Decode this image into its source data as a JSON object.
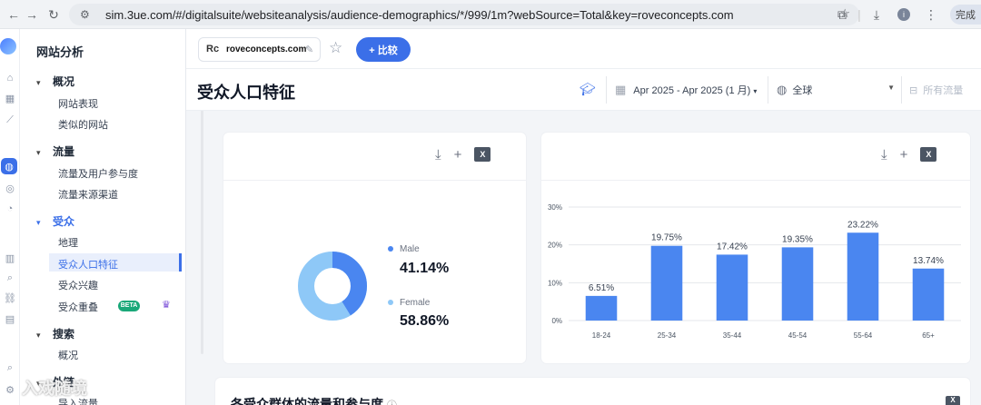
{
  "browser": {
    "url": "sim.3ue.com/#/digitalsuite/websiteanalysis/audience-demographics/*/999/1m?webSource=Total&key=roveconcepts.com",
    "profile_label": "完成",
    "avatar_initial": "i"
  },
  "sidebar": {
    "title": "网站分析",
    "sections": [
      {
        "label": "概况",
        "items": [
          "网站表现",
          "类似的网站"
        ]
      },
      {
        "label": "流量",
        "items": [
          "流量及用户参与度",
          "流量来源渠道"
        ]
      },
      {
        "label": "受众",
        "items": [
          "地理",
          "受众人口特征",
          "受众兴趣",
          "受众重叠"
        ]
      },
      {
        "label": "搜索",
        "items": [
          "概况"
        ]
      },
      {
        "label": "外链",
        "items": [
          "导入流量"
        ]
      }
    ],
    "beta_badge": "BETA"
  },
  "header": {
    "domain": "roveconcepts.com",
    "favicon_text": "Rc",
    "compare_label": "+ 比较"
  },
  "page": {
    "title": "受众人口特征",
    "date_range": "Apr 2025 - Apr 2025 (1 月)",
    "geo": "全球",
    "traffic": "所有流量"
  },
  "gender_card": {
    "male_label": "Male",
    "male_value": "41.14%",
    "female_label": "Female",
    "female_value": "58.86%",
    "male_color": "#4a86f0",
    "female_color": "#8ec8f7"
  },
  "chart_data": {
    "type": "bar",
    "categories": [
      "18-24",
      "25-34",
      "35-44",
      "45-54",
      "55-64",
      "65+"
    ],
    "values": [
      6.51,
      19.75,
      17.42,
      19.35,
      23.22,
      13.74
    ],
    "value_labels": [
      "6.51%",
      "19.75%",
      "17.42%",
      "19.35%",
      "23.22%",
      "13.74%"
    ],
    "yticks": [
      "0%",
      "10%",
      "20%",
      "30%"
    ],
    "ylim": [
      0,
      30
    ],
    "grid": true,
    "bar_color": "#4a86f0"
  },
  "bottom_card": {
    "title": "各受众群体的流量和参与度"
  },
  "watermark": "入戏随境"
}
